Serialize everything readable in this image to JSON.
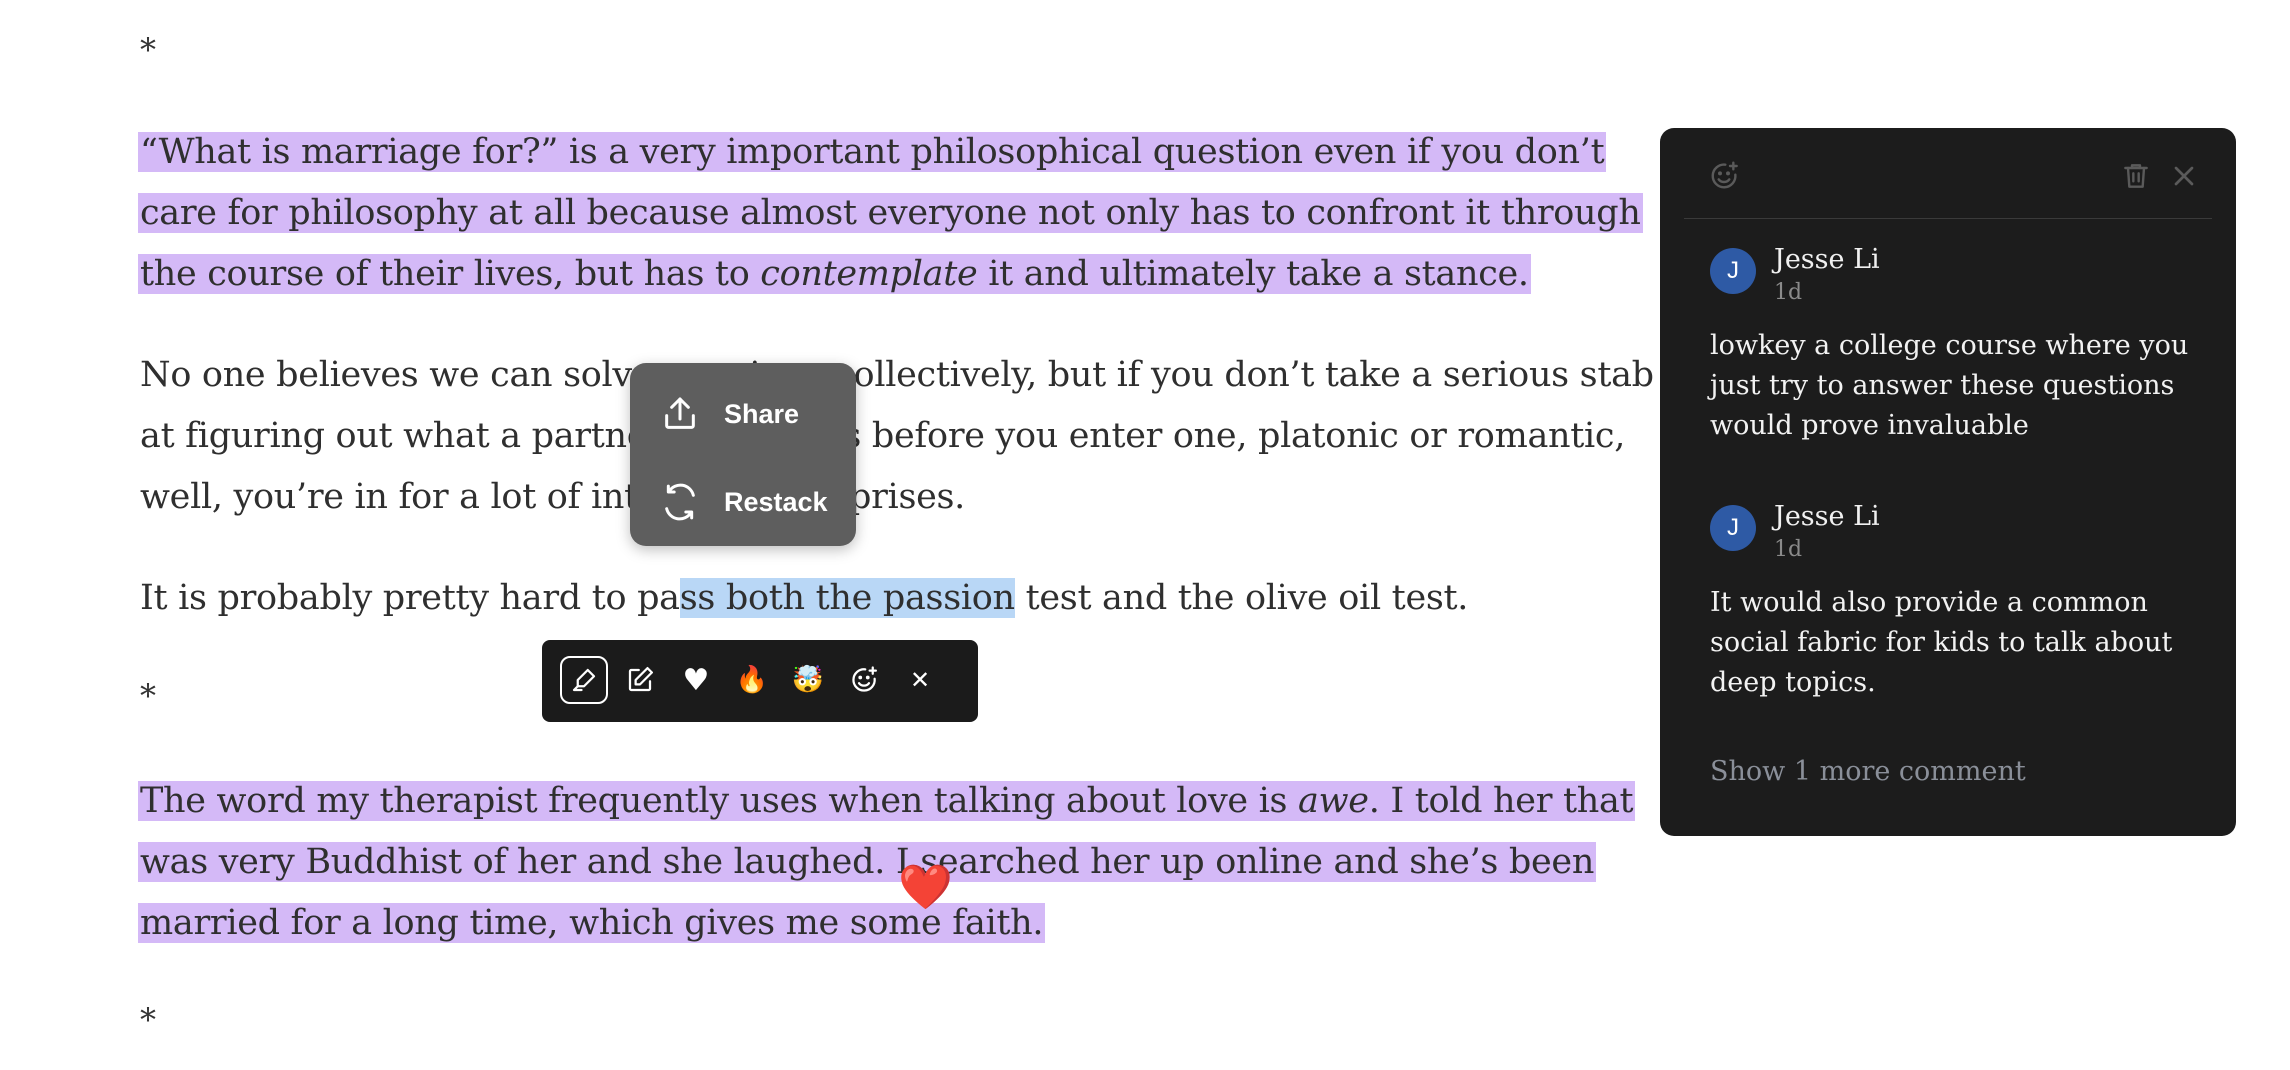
{
  "article": {
    "separators": [
      "*",
      "*",
      "*"
    ],
    "p1_lines": [
      "“What is marriage for?” is a very important philosophical question even if you don’t",
      "care for philosophy at all because almost everyone not only has to confront it through"
    ],
    "p1_l3_a": "the course of their lives, but has to ",
    "p1_l3_em": "contemplate",
    "p1_l3_b": " it and ultimately take a stance.",
    "p2_lines": [
      "No one believes we can solve marriage collectively, but if you don’t take a serious stab",
      "at figuring out what a partnership means before you enter one, platonic or romantic,",
      "well, you’re in for a lot of interesting surprises."
    ],
    "p3_pre": "It is probably pretty hard to pa",
    "p3_sel": "ss both the passion",
    "p3_post": " test and the olive oil test.",
    "p4_l1_a": "The word my therapist frequently uses when talking about love is ",
    "p4_l1_em": "awe",
    "p4_l1_b": ". I told her that",
    "p4_l2": "was very Buddhist of her and she laughed. I searched her up online and she’s been",
    "p4_l3": "married for a long time, which gives me some faith."
  },
  "share_menu": {
    "share_label": "Share",
    "restack_label": "Restack"
  },
  "toolbar": {
    "icons": [
      "highlighter-icon",
      "edit-note-icon",
      "heart-icon",
      "fire-emoji-icon",
      "mind-blown-emoji-icon",
      "add-reaction-icon",
      "close-icon"
    ],
    "heart": "♥",
    "fire": "🔥",
    "mindblown": "🤯",
    "close": "✕"
  },
  "floating_reaction": "❤️",
  "comments_panel": {
    "comments": [
      {
        "avatar": "J",
        "author": "Jesse Li",
        "time": "1d",
        "text": "lowkey a college course where you just try to answer these questions would prove invaluable"
      },
      {
        "avatar": "J",
        "author": "Jesse Li",
        "time": "1d",
        "text": "It would also provide a common social fabric for kids to talk about deep topics."
      }
    ],
    "show_more": "Show 1 more comment"
  },
  "colors": {
    "highlight": "#d4b9f7",
    "selection": "#b9d7f6",
    "panel_bg": "#1c1c1c",
    "avatar": "#2e5aa5"
  }
}
